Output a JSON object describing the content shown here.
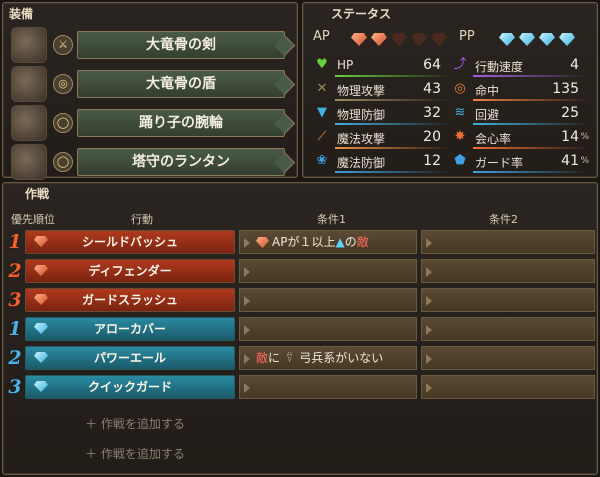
{
  "equipment": {
    "title": "装備",
    "items": [
      {
        "name": "大竜骨の剣",
        "slot_icon": "sword-icon",
        "slot_glyph": "⚔"
      },
      {
        "name": "大竜骨の盾",
        "slot_icon": "shield-icon",
        "slot_glyph": "◎"
      },
      {
        "name": "踊り子の腕輪",
        "slot_icon": "ring-icon",
        "slot_glyph": "◯"
      },
      {
        "name": "塔守のランタン",
        "slot_icon": "accessory-icon",
        "slot_glyph": "◯"
      }
    ]
  },
  "status": {
    "title": "ステータス",
    "ap_label": "AP",
    "ap_filled": 2,
    "ap_total": 5,
    "pp_label": "PP",
    "pp_filled": 4,
    "pp_total": 4,
    "stats": [
      {
        "label": "HP",
        "value": "64",
        "pct": "",
        "icon": "heart-icon",
        "glyph": "♥",
        "color": "#6ad040"
      },
      {
        "label": "行動速度",
        "value": "4",
        "pct": "",
        "icon": "speed-icon",
        "glyph": "⤴",
        "color": "#a060e0"
      },
      {
        "label": "物理攻撃",
        "value": "43",
        "pct": "",
        "icon": "physical-attack-icon",
        "glyph": "✕",
        "color": "#a08a60"
      },
      {
        "label": "命中",
        "value": "135",
        "pct": "",
        "icon": "accuracy-icon",
        "glyph": "◎",
        "color": "#f08040"
      },
      {
        "label": "物理防御",
        "value": "32",
        "pct": "",
        "icon": "physical-defense-icon",
        "glyph": "▼",
        "color": "#40b0e0"
      },
      {
        "label": "回避",
        "value": "25",
        "pct": "",
        "icon": "evasion-icon",
        "glyph": "≋",
        "color": "#40b0e0"
      },
      {
        "label": "魔法攻撃",
        "value": "20",
        "pct": "",
        "icon": "magic-attack-icon",
        "glyph": "⟋",
        "color": "#f09040"
      },
      {
        "label": "会心率",
        "value": "14",
        "pct": "%",
        "icon": "critical-icon",
        "glyph": "✸",
        "color": "#f07030"
      },
      {
        "label": "魔法防御",
        "value": "12",
        "pct": "",
        "icon": "magic-defense-icon",
        "glyph": "❀",
        "color": "#40a0e0"
      },
      {
        "label": "ガード率",
        "value": "41",
        "pct": "%",
        "icon": "guard-icon",
        "glyph": "⬟",
        "color": "#40a0e0"
      }
    ]
  },
  "tactics": {
    "title": "作戦",
    "headers": {
      "priority": "優先順位",
      "action": "行動",
      "cond1": "条件1",
      "cond2": "条件2"
    },
    "rows": [
      {
        "rank": "1",
        "type": "red",
        "action": "シールドバッシュ",
        "cond1_pre": "APが１以上",
        "cond1_mid": "の",
        "cond1_post": "敵",
        "cond2": ""
      },
      {
        "rank": "2",
        "type": "red",
        "action": "ディフェンダー",
        "cond1_pre": "",
        "cond1_mid": "",
        "cond1_post": "",
        "cond2": ""
      },
      {
        "rank": "3",
        "type": "red",
        "action": "ガードスラッシュ",
        "cond1_pre": "",
        "cond1_mid": "",
        "cond1_post": "",
        "cond2": ""
      },
      {
        "rank": "1",
        "type": "blue",
        "action": "アローカバー",
        "cond1_pre": "",
        "cond1_mid": "",
        "cond1_post": "",
        "cond2": ""
      },
      {
        "rank": "2",
        "type": "blue",
        "action": "パワーエール",
        "cond1_pre": "敵",
        "cond1_mid": "に",
        "cond1_post": "弓兵系がいない",
        "cond2": ""
      },
      {
        "rank": "3",
        "type": "blue",
        "action": "クイックガード",
        "cond1_pre": "",
        "cond1_mid": "",
        "cond1_post": "",
        "cond2": ""
      }
    ],
    "add_label": "＋ 作戦を追加する"
  }
}
